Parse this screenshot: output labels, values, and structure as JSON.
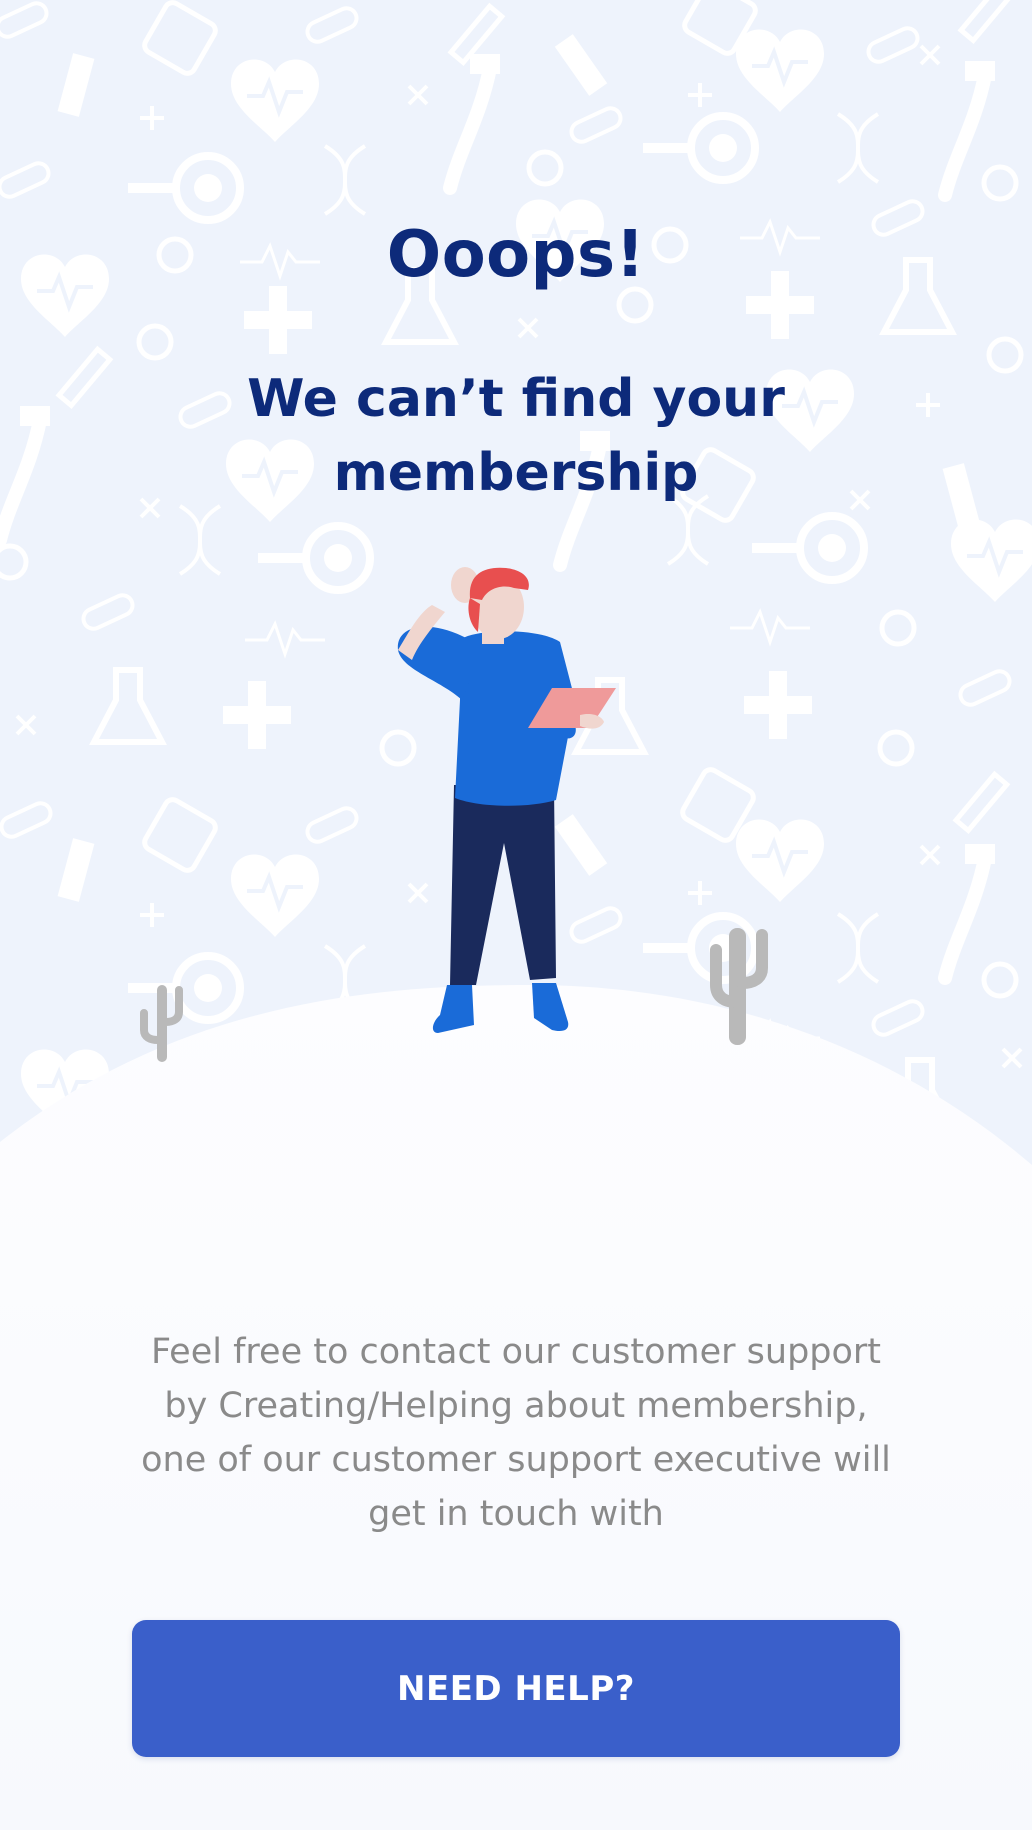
{
  "colors": {
    "background": "#f7f9fd",
    "pattern_background": "#eef3fc",
    "heading": "#0d2a7a",
    "body_text": "#8a8a8a",
    "button": "#3a5fca",
    "button_text": "#ffffff"
  },
  "header": {
    "title": "Ooops!",
    "subtitle": "We can’t find your membership"
  },
  "illustration": {
    "icon": "confused-man-with-tablet-illustration",
    "background_icons": [
      "heart-icon",
      "syringe-icon",
      "pill-icon",
      "plus-icon",
      "magnifier-tooth-icon",
      "dna-icon",
      "flask-icon",
      "microscope-icon",
      "stethoscope-icon",
      "heartbeat-line-icon",
      "cross-icon"
    ]
  },
  "message": {
    "text": "Feel free to contact our customer support by Creating/Helping about membership, one of our customer support executive will get in touch with"
  },
  "actions": {
    "help_label": "NEED HELP?"
  }
}
